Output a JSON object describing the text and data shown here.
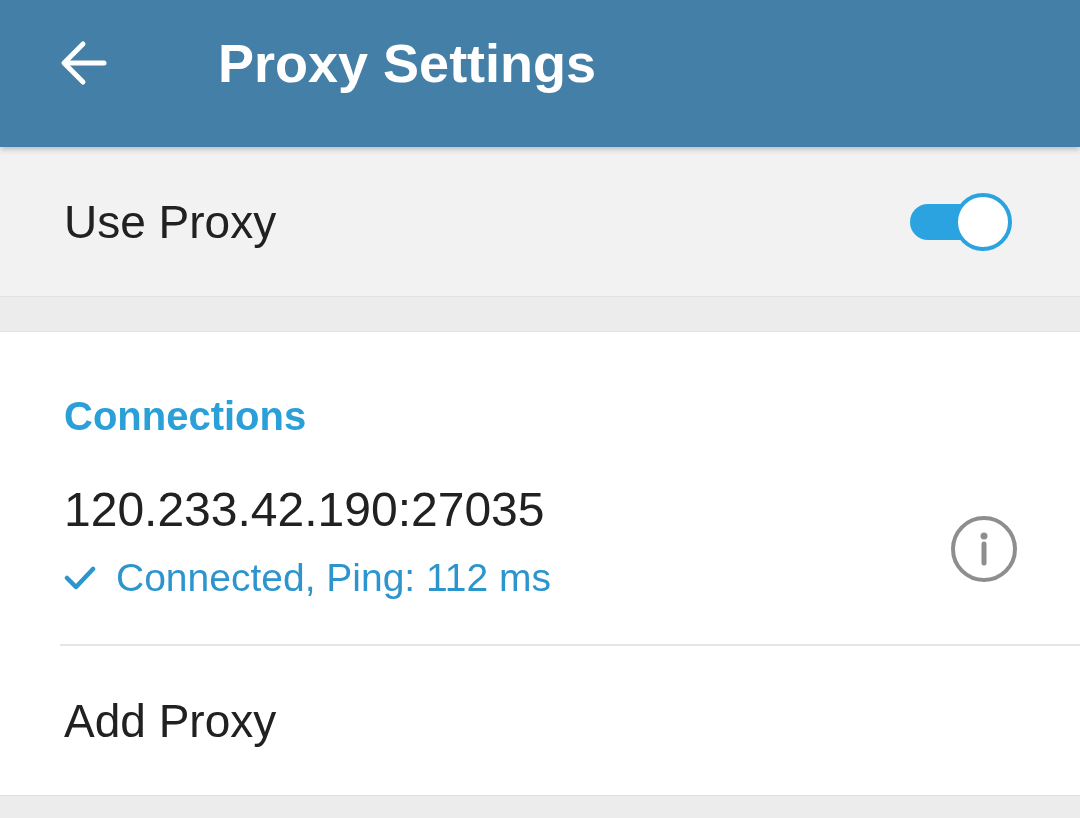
{
  "app_bar": {
    "title": "Proxy Settings"
  },
  "use_proxy": {
    "label": "Use Proxy",
    "on": true
  },
  "connections": {
    "header": "Connections",
    "items": [
      {
        "address": "120.233.42.190:27035",
        "status": "Connected, Ping: 112 ms",
        "connected": true
      }
    ]
  },
  "add_proxy": {
    "label": "Add Proxy"
  }
}
